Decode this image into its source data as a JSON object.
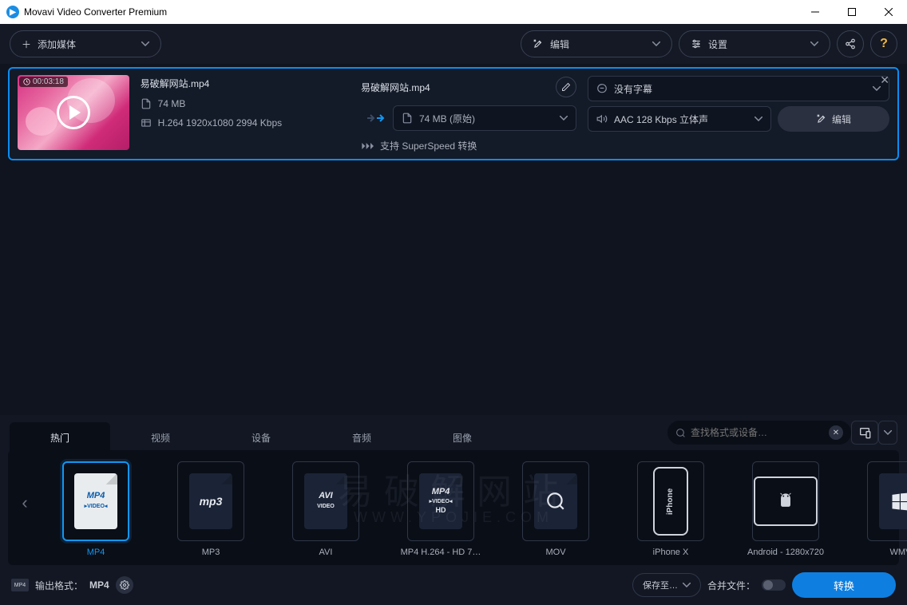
{
  "window": {
    "title": "Movavi Video Converter Premium"
  },
  "toolbar": {
    "add_media": "添加媒体",
    "edit": "编辑",
    "settings": "设置",
    "help": "?",
    "share": "share-icon"
  },
  "item": {
    "duration": "00:03:18",
    "source_name": "易破解网站.mp4",
    "source_size": "74 MB",
    "source_codec": "H.264 1920x1080 2994 Kbps",
    "target_name": "易破解网站.mp4",
    "target_size": "74 MB (原始)",
    "subtitle": "没有字幕",
    "audio": "AAC 128 Kbps 立体声",
    "superspeed": "支持 SuperSpeed 转换",
    "edit_label": "编辑"
  },
  "watermark": {
    "line1": "易破解网站",
    "line2": "WWW.YPOJIE.COM"
  },
  "tabs": {
    "t1": "热门",
    "t2": "视频",
    "t3": "设备",
    "t4": "音频",
    "t5": "图像"
  },
  "search": {
    "placeholder": "查找格式或设备…"
  },
  "formats": {
    "f0": "MP4",
    "f1": "MP3",
    "f2": "AVI",
    "f3": "MP4 H.264 - HD 7…",
    "f4": "MOV",
    "f5": "iPhone X",
    "f6": "Android - 1280x720",
    "f7": "WMV"
  },
  "tiles": {
    "mp4": "MP4\nVIDEO",
    "mp3": "mp3",
    "avi": "AVI\nVIDEO",
    "mp4hd": "MP4\nVIDEO\nHD",
    "wmv": "win-icon",
    "iphone": "iPhone"
  },
  "bottom": {
    "output_label": "输出格式：",
    "output_value": "MP4",
    "save_to": "保存至…",
    "merge": "合并文件：",
    "convert": "转换"
  }
}
